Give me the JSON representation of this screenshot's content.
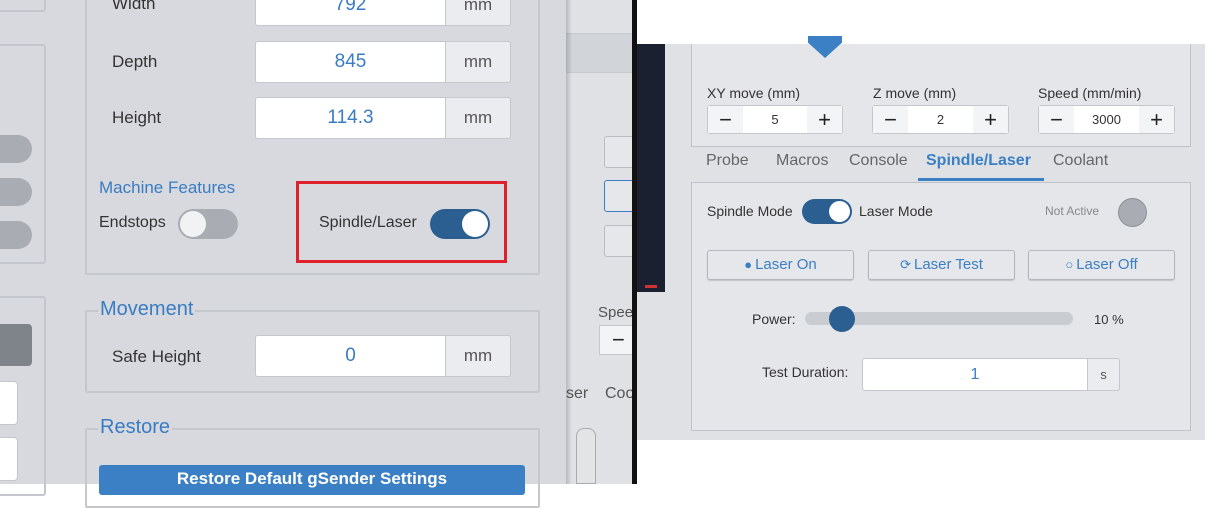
{
  "left_panel": {
    "dimensions": {
      "width": {
        "label": "Width",
        "value": "792",
        "unit": "mm"
      },
      "depth": {
        "label": "Depth",
        "value": "845",
        "unit": "mm"
      },
      "height": {
        "label": "Height",
        "value": "114.3",
        "unit": "mm"
      }
    },
    "machine_features": {
      "title": "Machine Features",
      "endstops": {
        "label": "Endstops",
        "enabled": false
      },
      "spindle_laser": {
        "label": "Spindle/Laser",
        "enabled": true
      }
    },
    "movement": {
      "title": "Movement",
      "safe_height": {
        "label": "Safe Height",
        "value": "0",
        "unit": "mm"
      }
    },
    "restore": {
      "title": "Restore",
      "button_label": "Restore Default gSender Settings"
    }
  },
  "middle": {
    "speed_partial": "Spee",
    "minus": "−",
    "tabs_partial": [
      "ser",
      "Coo"
    ]
  },
  "right_panel": {
    "jog": {
      "xy": {
        "label": "XY move (mm)",
        "value": "5"
      },
      "z": {
        "label": "Z move (mm)",
        "value": "2"
      },
      "speed": {
        "label": "Speed (mm/min)",
        "value": "3000"
      },
      "minus": "−",
      "plus": "+"
    },
    "tabs": [
      {
        "label": "Probe",
        "active": false
      },
      {
        "label": "Macros",
        "active": false
      },
      {
        "label": "Console",
        "active": false
      },
      {
        "label": "Spindle/Laser",
        "active": true
      },
      {
        "label": "Coolant",
        "active": false
      }
    ],
    "spindle": {
      "spindle_mode_label": "Spindle Mode",
      "laser_mode_label": "Laser Mode",
      "status": "Not Active",
      "buttons": {
        "laser_on": "Laser On",
        "laser_test": "Laser Test",
        "laser_off": "Laser Off"
      },
      "power": {
        "label": "Power:",
        "value": 10,
        "display": "10 %"
      },
      "test_duration": {
        "label": "Test Duration:",
        "value": "1",
        "unit": "s"
      }
    }
  },
  "colors": {
    "accent": "#3b7fc4",
    "toggle_on": "#2b5f91",
    "highlight": "#e0202a"
  }
}
